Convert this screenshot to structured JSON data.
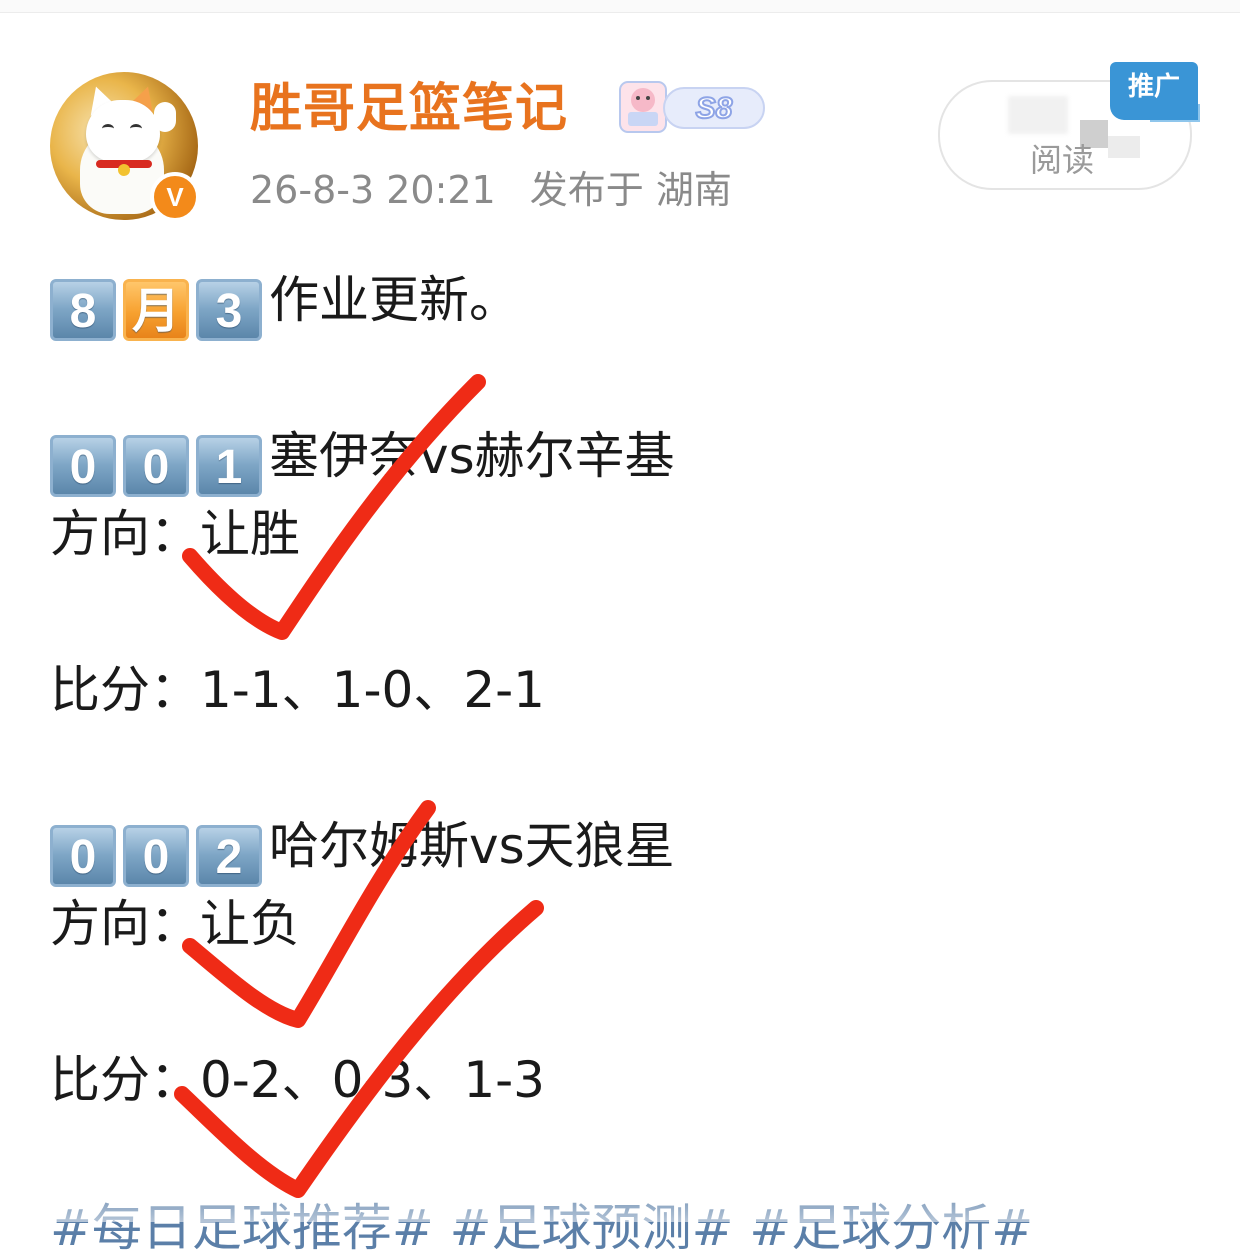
{
  "header": {
    "username": "胜哥足篮笔记",
    "level_badge": "S8",
    "timestamp": "26-8-3 20:21",
    "location": "发布于 湖南",
    "read_label": "阅读",
    "promo_tag": "推广",
    "verified_badge": "V"
  },
  "post": {
    "title": {
      "keycaps": [
        "8",
        "月",
        "3"
      ],
      "text": "作业更新。"
    },
    "matches": [
      {
        "keycaps": [
          "0",
          "0",
          "1"
        ],
        "teams": "塞伊奈vs赫尔辛基",
        "direction": "方向：让胜",
        "score": "比分：1-1、1-0、2-1"
      },
      {
        "keycaps": [
          "0",
          "0",
          "2"
        ],
        "teams": "哈尔姆斯vs天狼星",
        "direction": "方向：让负",
        "score": "比分：0-2、0-3、1-3"
      }
    ],
    "hashtags": "#每日足球推荐# #足球预测# #足球分析#"
  },
  "colors": {
    "username": "#e8731e",
    "meta": "#8a8a8a",
    "check_marks": "#ef2b16",
    "hashtag": "#5b7fa8",
    "promo": "#3a95d6"
  },
  "icons": [
    "lucky-cat-avatar",
    "verified-v-icon",
    "level-s8-icon",
    "keycap-emoji",
    "red-check-mark"
  ]
}
